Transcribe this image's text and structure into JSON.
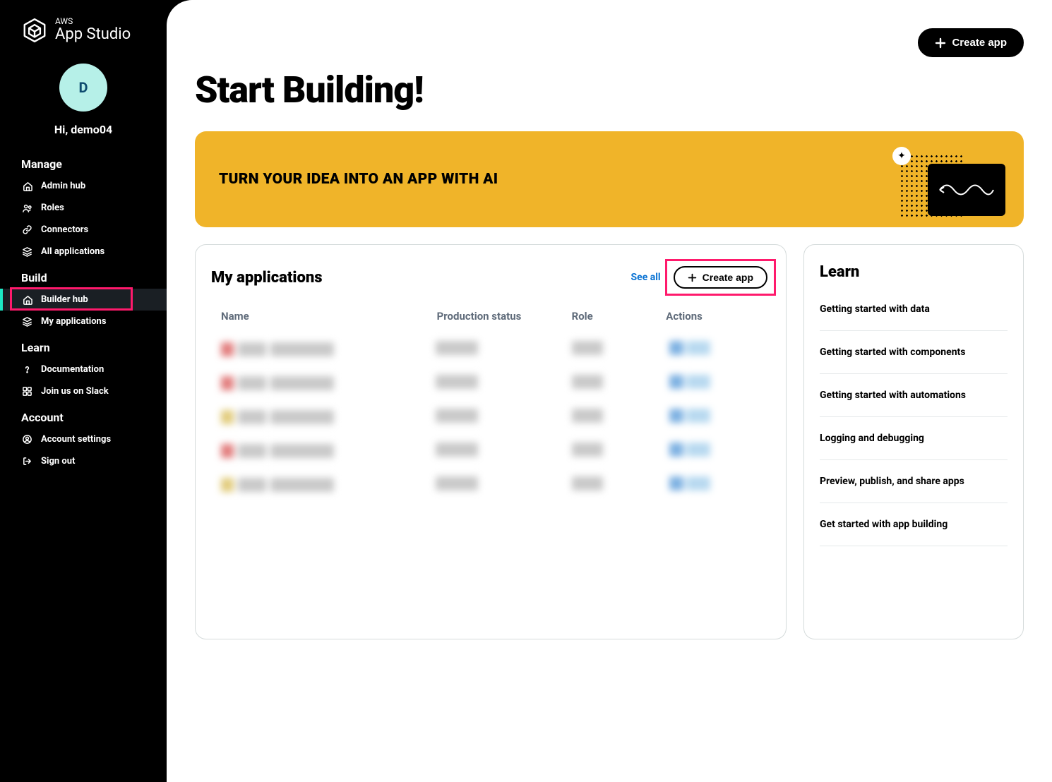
{
  "brand": {
    "top": "AWS",
    "name": "App Studio"
  },
  "user": {
    "initial": "D",
    "greeting": "Hi, demo04"
  },
  "sidebar": {
    "sections": [
      {
        "title": "Manage",
        "items": [
          {
            "label": "Admin hub",
            "icon": "home"
          },
          {
            "label": "Roles",
            "icon": "users"
          },
          {
            "label": "Connectors",
            "icon": "link"
          },
          {
            "label": "All applications",
            "icon": "layers"
          }
        ]
      },
      {
        "title": "Build",
        "items": [
          {
            "label": "Builder hub",
            "icon": "home",
            "active": true
          },
          {
            "label": "My applications",
            "icon": "layers"
          }
        ]
      },
      {
        "title": "Learn",
        "items": [
          {
            "label": "Documentation",
            "icon": "help"
          },
          {
            "label": "Join us on Slack",
            "icon": "slack"
          }
        ]
      },
      {
        "title": "Account",
        "items": [
          {
            "label": "Account settings",
            "icon": "user-circle"
          },
          {
            "label": "Sign out",
            "icon": "signout"
          }
        ]
      }
    ]
  },
  "header": {
    "create_app": "Create app",
    "title": "Start Building!"
  },
  "banner": {
    "title": "TURN YOUR IDEA INTO AN APP WITH AI"
  },
  "apps": {
    "title": "My applications",
    "see_all": "See all",
    "create": "Create app",
    "columns": {
      "name": "Name",
      "status": "Production status",
      "role": "Role",
      "actions": "Actions"
    },
    "rows": [
      {
        "color": "red"
      },
      {
        "color": "red"
      },
      {
        "color": "yellow"
      },
      {
        "color": "red"
      },
      {
        "color": "yellow"
      }
    ]
  },
  "learn": {
    "title": "Learn",
    "items": [
      "Getting started with data",
      "Getting started with components",
      "Getting started with automations",
      "Logging and debugging",
      "Preview, publish, and share apps",
      "Get started with app building"
    ]
  }
}
